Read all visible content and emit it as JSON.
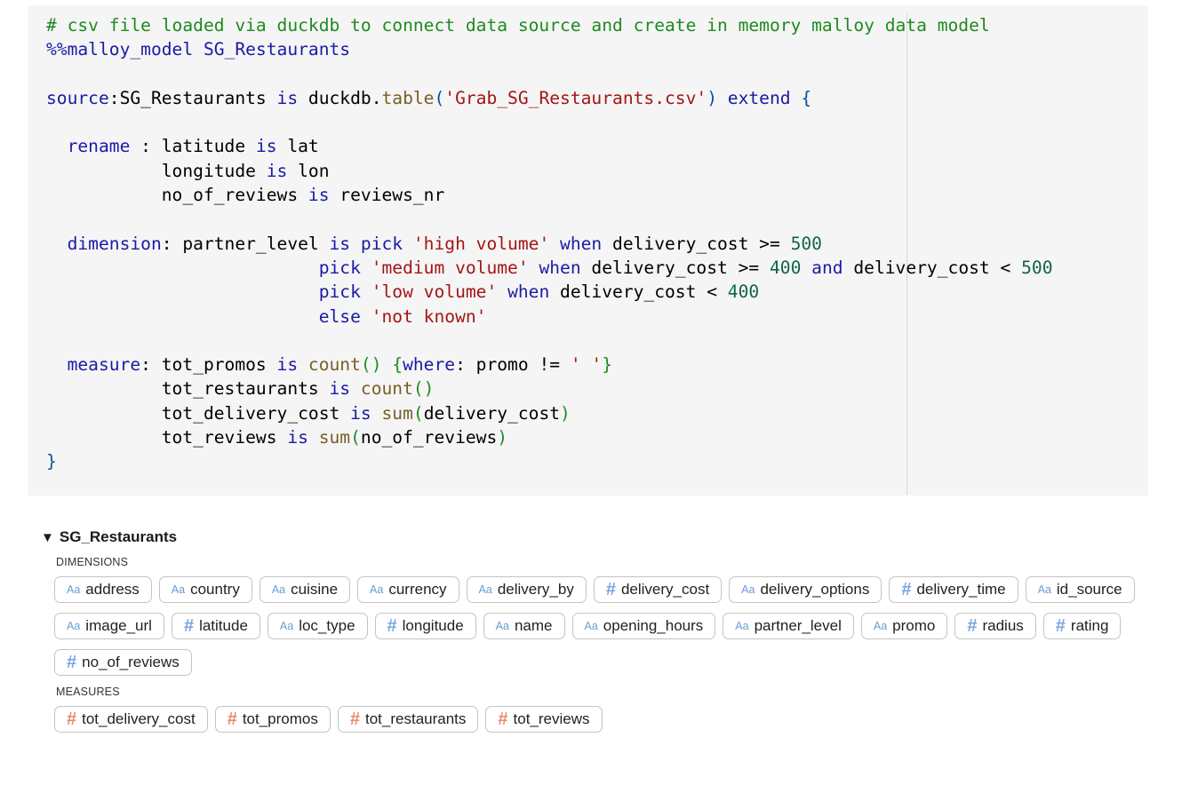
{
  "code_cell": {
    "lines": [
      [
        {
          "t": "# csv file loaded via duckdb to connect data source and create in memory malloy data model",
          "c": "comment"
        }
      ],
      [
        {
          "t": "%%malloy_model SG_Restaurants",
          "c": "kw"
        }
      ],
      [],
      [
        {
          "t": "source",
          "c": "kw"
        },
        {
          "t": ":SG_Restaurants ",
          "c": ""
        },
        {
          "t": "is",
          "c": "kw"
        },
        {
          "t": " duckdb.",
          "c": ""
        },
        {
          "t": "table",
          "c": "fn"
        },
        {
          "t": "(",
          "c": "br2"
        },
        {
          "t": "'Grab_SG_Restaurants.csv'",
          "c": "str"
        },
        {
          "t": ")",
          "c": "br2"
        },
        {
          "t": " ",
          "c": ""
        },
        {
          "t": "extend",
          "c": "kw"
        },
        {
          "t": " {",
          "c": "br2"
        }
      ],
      [],
      [
        {
          "t": "  ",
          "c": ""
        },
        {
          "t": "rename",
          "c": "kw"
        },
        {
          "t": " : latitude ",
          "c": ""
        },
        {
          "t": "is",
          "c": "kw"
        },
        {
          "t": " lat",
          "c": ""
        }
      ],
      [
        {
          "t": "           longitude ",
          "c": ""
        },
        {
          "t": "is",
          "c": "kw"
        },
        {
          "t": " lon",
          "c": ""
        }
      ],
      [
        {
          "t": "           no_of_reviews ",
          "c": ""
        },
        {
          "t": "is",
          "c": "kw"
        },
        {
          "t": " reviews_nr",
          "c": ""
        }
      ],
      [],
      [
        {
          "t": "  ",
          "c": ""
        },
        {
          "t": "dimension",
          "c": "kw"
        },
        {
          "t": ": partner_level ",
          "c": ""
        },
        {
          "t": "is",
          "c": "kw"
        },
        {
          "t": " ",
          "c": ""
        },
        {
          "t": "pick",
          "c": "kw"
        },
        {
          "t": " ",
          "c": ""
        },
        {
          "t": "'high volume'",
          "c": "str"
        },
        {
          "t": " ",
          "c": ""
        },
        {
          "t": "when",
          "c": "kw"
        },
        {
          "t": " delivery_cost >= ",
          "c": ""
        },
        {
          "t": "500",
          "c": "num"
        }
      ],
      [
        {
          "t": "                          ",
          "c": ""
        },
        {
          "t": "pick",
          "c": "kw"
        },
        {
          "t": " ",
          "c": ""
        },
        {
          "t": "'medium volume'",
          "c": "str"
        },
        {
          "t": " ",
          "c": ""
        },
        {
          "t": "when",
          "c": "kw"
        },
        {
          "t": " delivery_cost >= ",
          "c": ""
        },
        {
          "t": "400",
          "c": "num"
        },
        {
          "t": " ",
          "c": ""
        },
        {
          "t": "and",
          "c": "kw"
        },
        {
          "t": " delivery_cost < ",
          "c": ""
        },
        {
          "t": "500",
          "c": "num"
        }
      ],
      [
        {
          "t": "                          ",
          "c": ""
        },
        {
          "t": "pick",
          "c": "kw"
        },
        {
          "t": " ",
          "c": ""
        },
        {
          "t": "'low volume'",
          "c": "str"
        },
        {
          "t": " ",
          "c": ""
        },
        {
          "t": "when",
          "c": "kw"
        },
        {
          "t": " delivery_cost < ",
          "c": ""
        },
        {
          "t": "400",
          "c": "num"
        }
      ],
      [
        {
          "t": "                          ",
          "c": ""
        },
        {
          "t": "else",
          "c": "kw"
        },
        {
          "t": " ",
          "c": ""
        },
        {
          "t": "'not known'",
          "c": "str"
        }
      ],
      [],
      [
        {
          "t": "  ",
          "c": ""
        },
        {
          "t": "measure",
          "c": "kw"
        },
        {
          "t": ": tot_promos ",
          "c": ""
        },
        {
          "t": "is",
          "c": "kw"
        },
        {
          "t": " ",
          "c": ""
        },
        {
          "t": "count",
          "c": "fn"
        },
        {
          "t": "()",
          "c": "br"
        },
        {
          "t": " ",
          "c": ""
        },
        {
          "t": "{",
          "c": "br"
        },
        {
          "t": "where",
          "c": "kw"
        },
        {
          "t": ": promo != ",
          "c": ""
        },
        {
          "t": "' '",
          "c": "str"
        },
        {
          "t": "}",
          "c": "br"
        }
      ],
      [
        {
          "t": "           tot_restaurants ",
          "c": ""
        },
        {
          "t": "is",
          "c": "kw"
        },
        {
          "t": " ",
          "c": ""
        },
        {
          "t": "count",
          "c": "fn"
        },
        {
          "t": "()",
          "c": "br"
        }
      ],
      [
        {
          "t": "           tot_delivery_cost ",
          "c": ""
        },
        {
          "t": "is",
          "c": "kw"
        },
        {
          "t": " ",
          "c": ""
        },
        {
          "t": "sum",
          "c": "fn"
        },
        {
          "t": "(",
          "c": "br"
        },
        {
          "t": "delivery_cost",
          "c": ""
        },
        {
          "t": ")",
          "c": "br"
        }
      ],
      [
        {
          "t": "           tot_reviews ",
          "c": ""
        },
        {
          "t": "is",
          "c": "kw"
        },
        {
          "t": " ",
          "c": ""
        },
        {
          "t": "sum",
          "c": "fn"
        },
        {
          "t": "(",
          "c": "br"
        },
        {
          "t": "no_of_reviews",
          "c": ""
        },
        {
          "t": ")",
          "c": "br"
        }
      ],
      [
        {
          "t": "}",
          "c": "br2"
        }
      ]
    ]
  },
  "schema": {
    "toggle_icon": "triangle-down-icon",
    "toggle_glyph": "▼",
    "source_name": "SG_Restaurants",
    "dimensions_label": "DIMENSIONS",
    "measures_label": "MEASURES",
    "dimensions": [
      {
        "name": "address",
        "type": "string"
      },
      {
        "name": "country",
        "type": "string"
      },
      {
        "name": "cuisine",
        "type": "string"
      },
      {
        "name": "currency",
        "type": "string"
      },
      {
        "name": "delivery_by",
        "type": "string"
      },
      {
        "name": "delivery_cost",
        "type": "number"
      },
      {
        "name": "delivery_options",
        "type": "string"
      },
      {
        "name": "delivery_time",
        "type": "number"
      },
      {
        "name": "id_source",
        "type": "string"
      },
      {
        "name": "image_url",
        "type": "string"
      },
      {
        "name": "latitude",
        "type": "number"
      },
      {
        "name": "loc_type",
        "type": "string"
      },
      {
        "name": "longitude",
        "type": "number"
      },
      {
        "name": "name",
        "type": "string"
      },
      {
        "name": "opening_hours",
        "type": "string"
      },
      {
        "name": "partner_level",
        "type": "string"
      },
      {
        "name": "promo",
        "type": "string"
      },
      {
        "name": "radius",
        "type": "number"
      },
      {
        "name": "rating",
        "type": "number"
      },
      {
        "name": "no_of_reviews",
        "type": "number"
      }
    ],
    "measures": [
      {
        "name": "tot_delivery_cost",
        "type": "number"
      },
      {
        "name": "tot_promos",
        "type": "number"
      },
      {
        "name": "tot_restaurants",
        "type": "number"
      },
      {
        "name": "tot_reviews",
        "type": "number"
      }
    ],
    "icons": {
      "string": {
        "name": "string-type-icon",
        "glyph": "Aa"
      },
      "number": {
        "name": "number-type-icon",
        "glyph": "#"
      }
    }
  }
}
